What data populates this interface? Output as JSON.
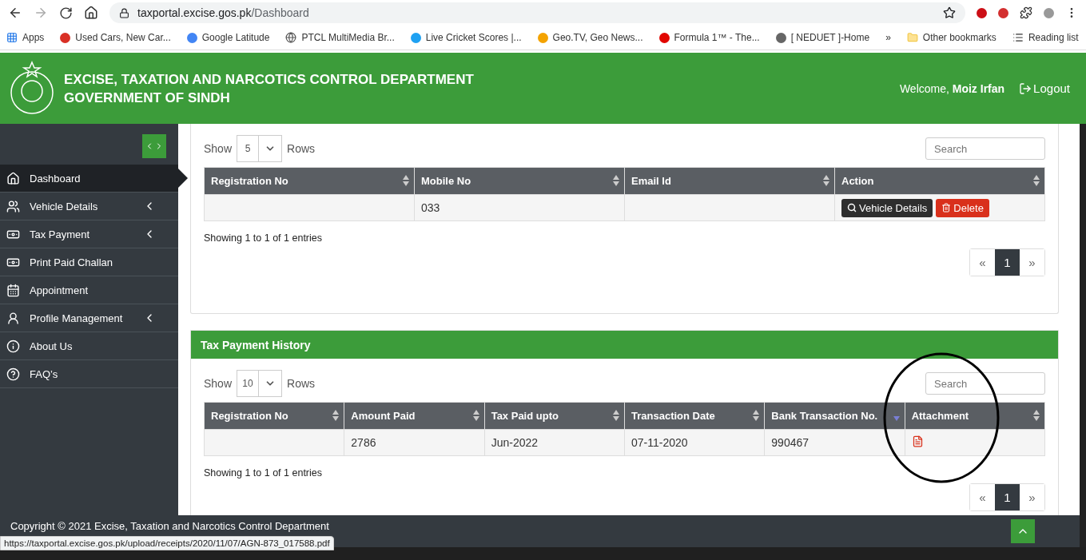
{
  "browser": {
    "url_host": "taxportal.excise.gos.pk",
    "url_path": "/Dashboard",
    "bookmarks": [
      {
        "label": "Apps"
      },
      {
        "label": "Used Cars, New Car..."
      },
      {
        "label": "Google Latitude"
      },
      {
        "label": "PTCL MultiMedia Br..."
      },
      {
        "label": "Live Cricket Scores |..."
      },
      {
        "label": "Geo.TV, Geo News..."
      },
      {
        "label": "Formula 1™ - The..."
      },
      {
        "label": "[ NEDUET ]-Home"
      }
    ],
    "overflow": "»",
    "other_bookmarks": "Other bookmarks",
    "reading_list": "Reading list"
  },
  "header": {
    "title_line_1": "EXCISE, TAXATION AND NARCOTICS CONTROL DEPARTMENT",
    "title_line_2": "GOVERNMENT OF SINDH",
    "welcome": "Welcome,",
    "user": "Moiz Irfan",
    "logout": "Logout"
  },
  "sidebar": {
    "items": [
      {
        "label": "Dashboard",
        "selected": true,
        "expandable": false
      },
      {
        "label": "Vehicle Details",
        "selected": false,
        "expandable": true
      },
      {
        "label": "Tax Payment",
        "selected": false,
        "expandable": true
      },
      {
        "label": "Print Paid Challan",
        "selected": false,
        "expandable": false
      },
      {
        "label": "Appointment",
        "selected": false,
        "expandable": false
      },
      {
        "label": "Profile Management",
        "selected": false,
        "expandable": true
      },
      {
        "label": "About Us",
        "selected": false,
        "expandable": false
      },
      {
        "label": "FAQ’s",
        "selected": false,
        "expandable": false
      }
    ]
  },
  "vehicles_card": {
    "show_label": "Show",
    "rows_value": "5",
    "rows_label": "Rows",
    "search_placeholder": "Search",
    "columns": [
      {
        "label": "Registration No",
        "sorted": false
      },
      {
        "label": "Mobile No",
        "sorted": false
      },
      {
        "label": "Email Id",
        "sorted": false
      },
      {
        "label": "Action",
        "sorted": false
      }
    ],
    "rows": [
      {
        "cells": [
          null,
          "033",
          null
        ],
        "actions": [
          {
            "label": "Vehicle Details",
            "kind": "view"
          },
          {
            "label": "Delete",
            "kind": "delete"
          }
        ]
      }
    ],
    "info": "Showing 1 to 1 of 1 entries",
    "pages": [
      {
        "label": "«",
        "selected": false
      },
      {
        "label": "1",
        "selected": true
      },
      {
        "label": "»",
        "selected": false
      }
    ]
  },
  "history_card": {
    "title": "Tax Payment History",
    "show_label": "Show",
    "rows_value": "10",
    "rows_label": "Rows",
    "search_placeholder": "Search",
    "columns": [
      {
        "label": "Registration No",
        "sorted": false
      },
      {
        "label": "Amount Paid",
        "sorted": false
      },
      {
        "label": "Tax Paid upto",
        "sorted": false
      },
      {
        "label": "Transaction Date",
        "sorted": false
      },
      {
        "label": "Bank Transaction No.",
        "sorted": true
      },
      {
        "label": "Attachment",
        "sorted": false
      }
    ],
    "rows": [
      {
        "cells": [
          null,
          "2786",
          "Jun-2022",
          "07-11-2020",
          "990467"
        ],
        "attachment": {
          "kind": "pdf"
        }
      }
    ],
    "info": "Showing 1 to 1 of 1 entries",
    "pages": [
      {
        "label": "«",
        "selected": false
      },
      {
        "label": "1",
        "selected": true
      },
      {
        "label": "»",
        "selected": false
      }
    ]
  },
  "footer": {
    "copyright": "Copyright © 2021 Excise, Taxation and Narcotics Control Department"
  },
  "status_url": "https://taxportal.excise.gos.pk/upload/receipts/2020/11/07/AGN-873_017588.pdf"
}
